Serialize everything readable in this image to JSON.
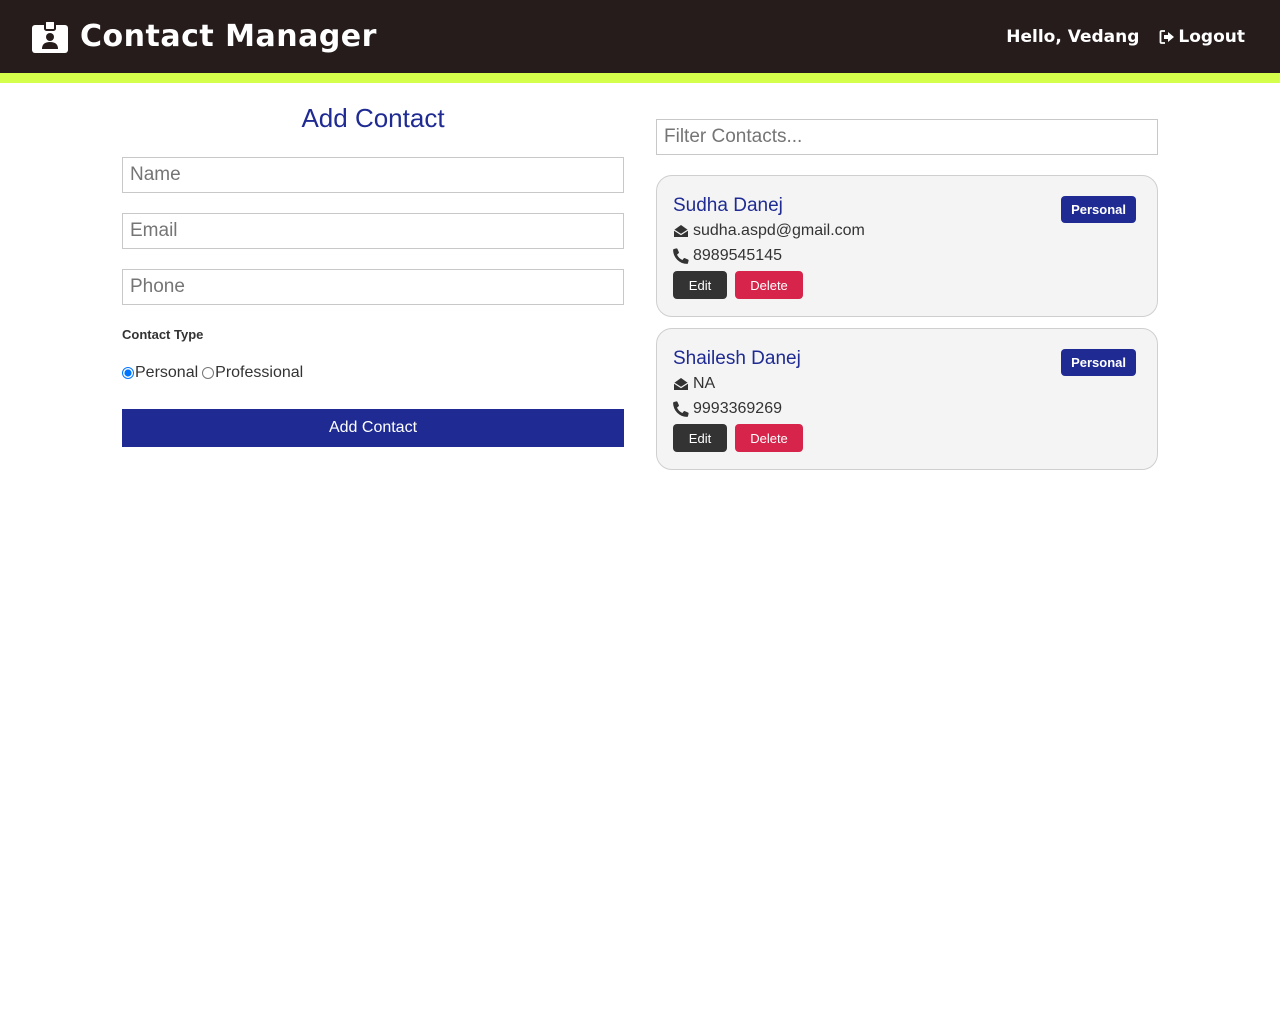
{
  "colors": {
    "navbar_bg": "#261c1c",
    "accent_bar": "#d4ff4a",
    "primary": "#1f2b93",
    "danger": "#d6244a",
    "dark": "#333333"
  },
  "navbar": {
    "brand_icon": "id-badge-icon",
    "title": "Contact Manager",
    "greeting": "Hello, Vedang",
    "logout_icon": "sign-out-icon",
    "logout_label": "Logout"
  },
  "form": {
    "title": "Add Contact",
    "name_placeholder": "Name",
    "name_value": "",
    "email_placeholder": "Email",
    "email_value": "",
    "phone_placeholder": "Phone",
    "phone_value": "",
    "type_label": "Contact Type",
    "type_options": [
      "Personal",
      "Professional"
    ],
    "selected_type": "Personal",
    "submit_label": "Add Contact"
  },
  "filter": {
    "placeholder": "Filter Contacts...",
    "value": ""
  },
  "contacts": [
    {
      "name": "Sudha Danej",
      "type": "Personal",
      "email": "sudha.aspd@gmail.com",
      "phone": "8989545145",
      "edit_label": "Edit",
      "delete_label": "Delete"
    },
    {
      "name": "Shailesh Danej",
      "type": "Personal",
      "email": "NA",
      "phone": "9993369269",
      "edit_label": "Edit",
      "delete_label": "Delete"
    }
  ]
}
